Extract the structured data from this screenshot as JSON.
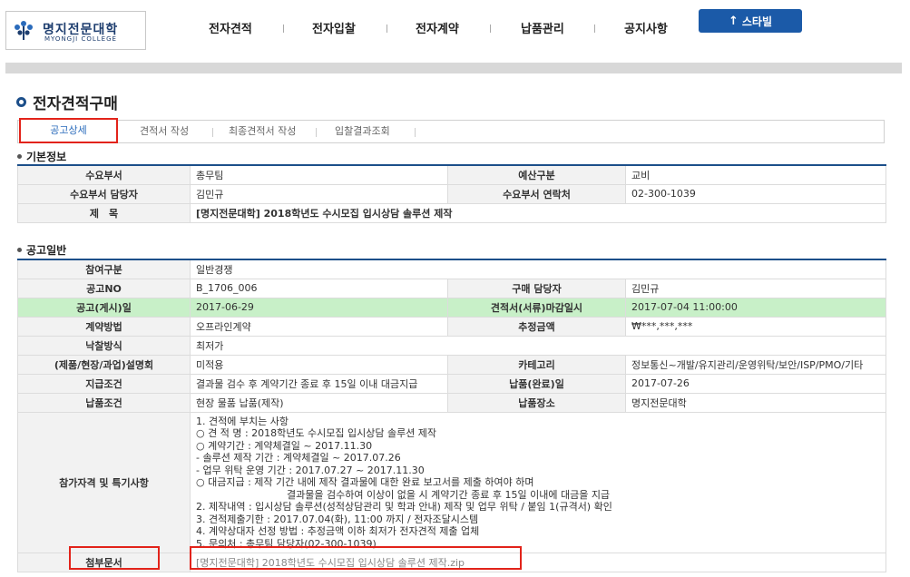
{
  "header": {
    "logo_ko": "명지전문대학",
    "logo_en": "MYONGJI COLLEGE",
    "nav": [
      "전자견적",
      "전자입찰",
      "전자계약",
      "납품관리",
      "공지사항"
    ],
    "starbill": "스타빌"
  },
  "page_title": "전자견적구매",
  "tabs": [
    "공고상세",
    "견적서 작성",
    "최종견적서 작성",
    "입찰결과조회"
  ],
  "basic": {
    "title": "기본정보",
    "dept_label": "수요부서",
    "dept_value": "총무팀",
    "budget_label": "예산구분",
    "budget_value": "교비",
    "manager_label": "수요부서 담당자",
    "manager_value": "김민규",
    "contact_label": "수요부서 연락처",
    "contact_value": "02-300-1039",
    "subject_label": "제　목",
    "subject_value": "[명지전문대학] 2018학년도 수시모집 입시상담 솔루션 제작"
  },
  "notice": {
    "title": "공고일반",
    "rows": {
      "participation_label": "참여구분",
      "participation_value": "일반경쟁",
      "no_label": "공고NO",
      "no_value": "B_1706_006",
      "buyer_label": "구매 담당자",
      "buyer_value": "김민규",
      "post_date_label": "공고(게시)일",
      "post_date_value": "2017-06-29",
      "deadline_label": "견적서(서류)마감일시",
      "deadline_value": "2017-07-04 11:00:00",
      "contract_label": "계약방법",
      "contract_value": "오프라인계약",
      "estimate_label": "추정금액",
      "estimate_value": "₩***,***,***",
      "award_label": "낙찰방식",
      "award_value": "최저가",
      "briefing_label": "(제품/현장/과업)설명회",
      "briefing_value": "미적용",
      "category_label": "카테고리",
      "category_value": "정보통신~개발/유지관리/운영위탁/보안/ISP/PMO/기타",
      "payment_label": "지급조건",
      "payment_value": "결과물 검수 후 계약기간 종료 후 15일 이내 대금지급",
      "delivery_date_label": "납품(완료)일",
      "delivery_date_value": "2017-07-26",
      "delivery_cond_label": "납품조건",
      "delivery_cond_value": "현장 물품 납품(제작)",
      "delivery_place_label": "납품장소",
      "delivery_place_value": "명지전문대학",
      "qualification_label": "참가자격 및 특기사항",
      "attach_label": "첨부문서",
      "attach_value": "[명지전문대학] 2018학년도 수시모집 입시상담 솔루션 제작.zip"
    },
    "notes": [
      "1. 견적에 부치는 사항",
      "○ 견 적 명 : 2018학년도 수시모집 입시상담 솔루션 제작",
      "○ 계약기간 : 계약체결일 ~ 2017.11.30",
      " - 솔루션 제작 기간 : 계약체결일 ~ 2017.07.26",
      " - 업무 위탁 운영 기간 : 2017.07.27 ~ 2017.11.30",
      "○ 대금지급 : 제작 기간 내에 제작 결과물에 대한 완료 보고서를 제출 하여야 하며",
      "결과물을 검수하여 이상이 없을 시 계약기간 종료 후 15일 이내에 대금을 지급",
      "2. 제작내역 : 입시상담 솔루션(성적상담관리 및 학과 안내) 제작 및 업무 위탁 / 붙임 1(규격서) 확인",
      "3. 견적제출기한 : 2017.07.04(화), 11:00 까지 / 전자조달시스템",
      "4. 계약상대자 선정 방법 : 추정금액 이하 최저가 전자견적 제출 업체",
      "5. 문의처 : 총무팀 담당자(02-300-1039)"
    ]
  },
  "colors": {
    "accent": "#1c4f8a",
    "highlight_row": "#c8f0c8",
    "red_box": "#e2231a",
    "button": "#1b5aa8"
  }
}
